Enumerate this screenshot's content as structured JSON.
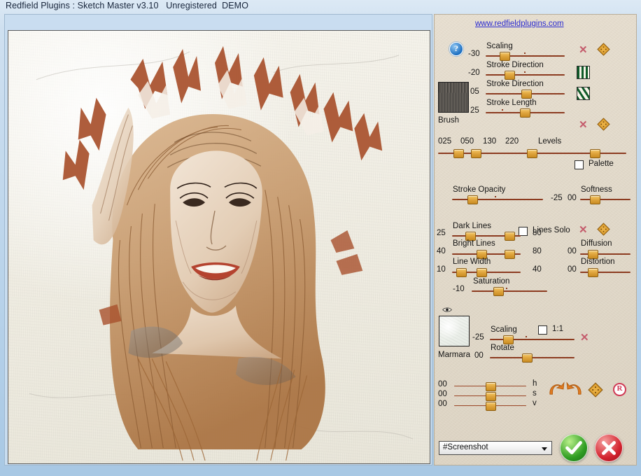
{
  "window": {
    "title": "Redfield Plugins : Sketch Master v3.10   Unregistered  DEMO"
  },
  "panel": {
    "url": "www.redfieldplugins.com",
    "help_icon": "?",
    "brush": {
      "label": "Brush",
      "swatch_name": "brush-texture-swatch"
    },
    "texture": {
      "label": "Marmara",
      "swatch_name": "marmara-texture-swatch"
    },
    "sliders": {
      "scaling": {
        "label": "Scaling",
        "value": "-30"
      },
      "stroke_direction_1": {
        "label": "Stroke Direction",
        "value": "-20"
      },
      "stroke_direction_2": {
        "label": "Stroke Direction",
        "value": "05"
      },
      "stroke_length": {
        "label": "Stroke Length",
        "value": "25"
      },
      "levels": {
        "label": "Levels",
        "values": [
          "025",
          "050",
          "130",
          "220"
        ]
      },
      "stroke_opacity": {
        "label": "Stroke Opacity",
        "value": "-25"
      },
      "softness": {
        "label": "Softness",
        "value": "00"
      },
      "dark_lines": {
        "label": "Dark Lines",
        "value_left": "25",
        "value_right": "80"
      },
      "bright_lines": {
        "label": "Bright Lines",
        "value_left": "40",
        "value_right": "80"
      },
      "line_width": {
        "label": "Line Width",
        "value_left": "10",
        "value_right": "40"
      },
      "diffusion": {
        "label": "Diffusion",
        "value": "00"
      },
      "distortion": {
        "label": "Distortion",
        "value": "00"
      },
      "saturation": {
        "label": "Saturation",
        "value": "-10"
      },
      "texture_scaling": {
        "label": "Scaling",
        "value": "-25"
      },
      "texture_rotate": {
        "label": "Rotate",
        "value": "00"
      },
      "hsv": [
        {
          "label": "h",
          "value": "00"
        },
        {
          "label": "s",
          "value": "00"
        },
        {
          "label": "v",
          "value": "00"
        }
      ]
    },
    "checkboxes": {
      "palette": {
        "label": "Palette",
        "checked": false
      },
      "lines_solo": {
        "label": "Lines Solo",
        "checked": false
      },
      "one_to_one": {
        "label": "1:1",
        "checked": false
      }
    }
  },
  "bottom": {
    "preset_value": "#Screenshot",
    "ok_label": "ok-check",
    "cancel_label": "cancel-cross"
  },
  "colors": {
    "track": "#8c3b20",
    "knob": "#e0a63f",
    "link": "#2a2ad0",
    "panel_bg": "#e2dacb",
    "ok": "#2f9d22",
    "cancel": "#d3222d"
  }
}
